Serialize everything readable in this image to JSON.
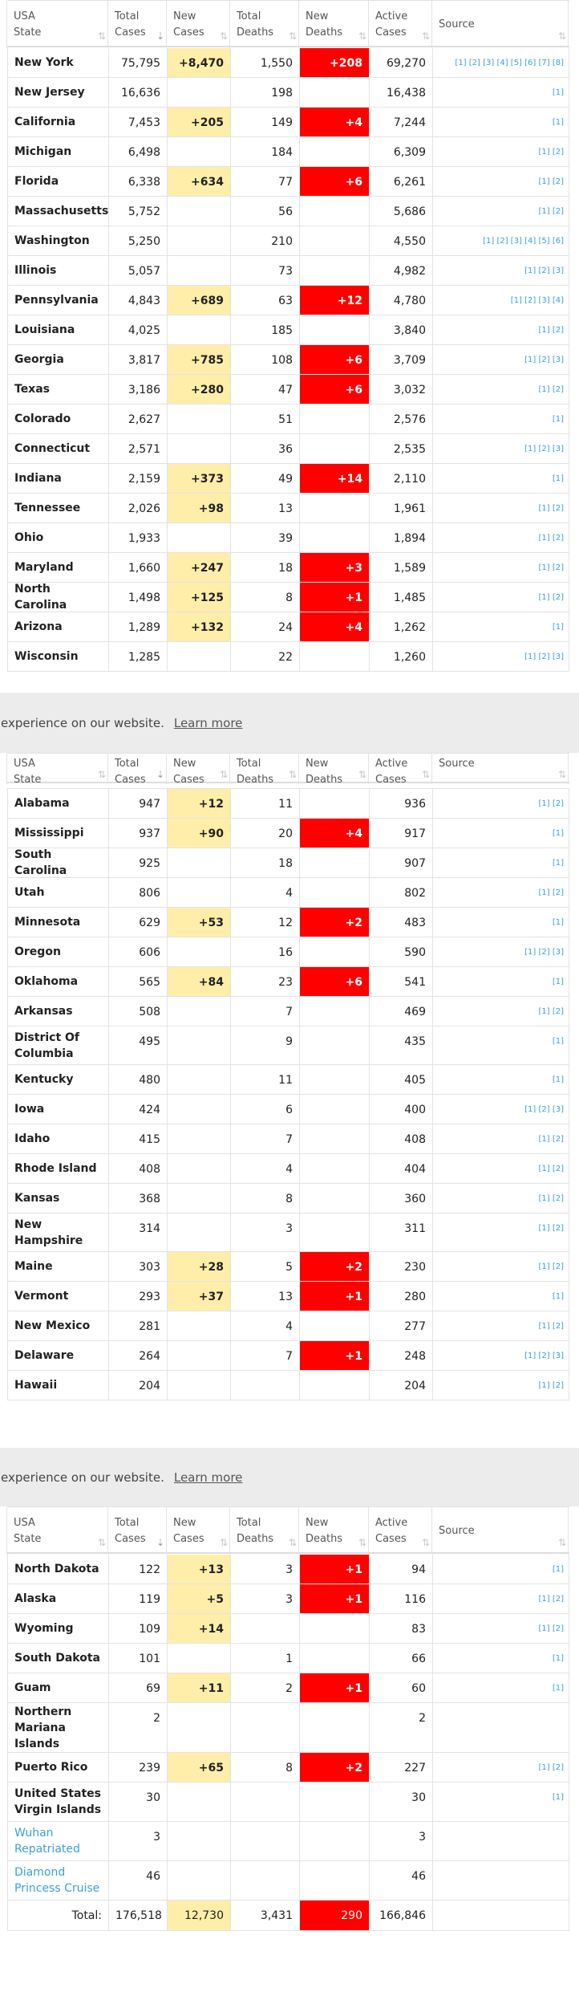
{
  "columns": {
    "state": [
      "USA",
      "State"
    ],
    "total_cases": [
      "Total",
      "Cases"
    ],
    "new_cases": [
      "New",
      "Cases"
    ],
    "total_deaths": [
      "Total",
      "Deaths"
    ],
    "new_deaths": [
      "New",
      "Deaths"
    ],
    "active_cases": [
      "Active",
      "Cases"
    ],
    "source": "Source",
    "sort_icon": "⇅",
    "sort_icon_active": "⇣"
  },
  "cookie_banner": {
    "text": "experience on our website.",
    "link": "Learn more"
  },
  "segments": [
    {
      "rows": [
        {
          "state": "New York",
          "total_cases": "75,795",
          "new_cases": "+8,470",
          "total_deaths": "1,550",
          "new_deaths": "+208",
          "active_cases": "69,270",
          "source": "[1] [2] [3] [4] [5] [6] [7] [8]"
        },
        {
          "state": "New Jersey",
          "total_cases": "16,636",
          "new_cases": "",
          "total_deaths": "198",
          "new_deaths": "",
          "active_cases": "16,438",
          "source": "[1]"
        },
        {
          "state": "California",
          "total_cases": "7,453",
          "new_cases": "+205",
          "total_deaths": "149",
          "new_deaths": "+4",
          "active_cases": "7,244",
          "source": "[1]"
        },
        {
          "state": "Michigan",
          "total_cases": "6,498",
          "new_cases": "",
          "total_deaths": "184",
          "new_deaths": "",
          "active_cases": "6,309",
          "source": "[1] [2]"
        },
        {
          "state": "Florida",
          "total_cases": "6,338",
          "new_cases": "+634",
          "total_deaths": "77",
          "new_deaths": "+6",
          "active_cases": "6,261",
          "source": "[1] [2]"
        },
        {
          "state": "Massachusetts",
          "total_cases": "5,752",
          "new_cases": "",
          "total_deaths": "56",
          "new_deaths": "",
          "active_cases": "5,686",
          "source": "[1] [2]"
        },
        {
          "state": "Washington",
          "total_cases": "5,250",
          "new_cases": "",
          "total_deaths": "210",
          "new_deaths": "",
          "active_cases": "4,550",
          "source": "[1] [2] [3] [4] [5] [6]"
        },
        {
          "state": "Illinois",
          "total_cases": "5,057",
          "new_cases": "",
          "total_deaths": "73",
          "new_deaths": "",
          "active_cases": "4,982",
          "source": "[1] [2] [3]"
        },
        {
          "state": "Pennsylvania",
          "total_cases": "4,843",
          "new_cases": "+689",
          "total_deaths": "63",
          "new_deaths": "+12",
          "active_cases": "4,780",
          "source": "[1] [2] [3] [4]"
        },
        {
          "state": "Louisiana",
          "total_cases": "4,025",
          "new_cases": "",
          "total_deaths": "185",
          "new_deaths": "",
          "active_cases": "3,840",
          "source": "[1] [2]"
        },
        {
          "state": "Georgia",
          "total_cases": "3,817",
          "new_cases": "+785",
          "total_deaths": "108",
          "new_deaths": "+6",
          "active_cases": "3,709",
          "source": "[1] [2] [3]"
        },
        {
          "state": "Texas",
          "total_cases": "3,186",
          "new_cases": "+280",
          "total_deaths": "47",
          "new_deaths": "+6",
          "active_cases": "3,032",
          "source": "[1] [2]"
        },
        {
          "state": "Colorado",
          "total_cases": "2,627",
          "new_cases": "",
          "total_deaths": "51",
          "new_deaths": "",
          "active_cases": "2,576",
          "source": "[1]"
        },
        {
          "state": "Connecticut",
          "total_cases": "2,571",
          "new_cases": "",
          "total_deaths": "36",
          "new_deaths": "",
          "active_cases": "2,535",
          "source": "[1] [2] [3]"
        },
        {
          "state": "Indiana",
          "total_cases": "2,159",
          "new_cases": "+373",
          "total_deaths": "49",
          "new_deaths": "+14",
          "active_cases": "2,110",
          "source": "[1]"
        },
        {
          "state": "Tennessee",
          "total_cases": "2,026",
          "new_cases": "+98",
          "total_deaths": "13",
          "new_deaths": "",
          "active_cases": "1,961",
          "source": "[1] [2]"
        },
        {
          "state": "Ohio",
          "total_cases": "1,933",
          "new_cases": "",
          "total_deaths": "39",
          "new_deaths": "",
          "active_cases": "1,894",
          "source": "[1] [2]"
        },
        {
          "state": "Maryland",
          "total_cases": "1,660",
          "new_cases": "+247",
          "total_deaths": "18",
          "new_deaths": "+3",
          "active_cases": "1,589",
          "source": "[1] [2]"
        },
        {
          "state": "North Carolina",
          "total_cases": "1,498",
          "new_cases": "+125",
          "total_deaths": "8",
          "new_deaths": "+1",
          "active_cases": "1,485",
          "source": "[1] [2]"
        },
        {
          "state": "Arizona",
          "total_cases": "1,289",
          "new_cases": "+132",
          "total_deaths": "24",
          "new_deaths": "+4",
          "active_cases": "1,262",
          "source": "[1]"
        },
        {
          "state": "Wisconsin",
          "total_cases": "1,285",
          "new_cases": "",
          "total_deaths": "22",
          "new_deaths": "",
          "active_cases": "1,260",
          "source": "[1] [2] [3]"
        }
      ]
    },
    {
      "rows": [
        {
          "state": "Alabama",
          "total_cases": "947",
          "new_cases": "+12",
          "total_deaths": "11",
          "new_deaths": "",
          "active_cases": "936",
          "source": "[1] [2]"
        },
        {
          "state": "Mississippi",
          "total_cases": "937",
          "new_cases": "+90",
          "total_deaths": "20",
          "new_deaths": "+4",
          "active_cases": "917",
          "source": "[1]"
        },
        {
          "state": "South Carolina",
          "total_cases": "925",
          "new_cases": "",
          "total_deaths": "18",
          "new_deaths": "",
          "active_cases": "907",
          "source": "[1]"
        },
        {
          "state": "Utah",
          "total_cases": "806",
          "new_cases": "",
          "total_deaths": "4",
          "new_deaths": "",
          "active_cases": "802",
          "source": "[1] [2]"
        },
        {
          "state": "Minnesota",
          "total_cases": "629",
          "new_cases": "+53",
          "total_deaths": "12",
          "new_deaths": "+2",
          "active_cases": "483",
          "source": "[1]"
        },
        {
          "state": "Oregon",
          "total_cases": "606",
          "new_cases": "",
          "total_deaths": "16",
          "new_deaths": "",
          "active_cases": "590",
          "source": "[1] [2] [3]"
        },
        {
          "state": "Oklahoma",
          "total_cases": "565",
          "new_cases": "+84",
          "total_deaths": "23",
          "new_deaths": "+6",
          "active_cases": "541",
          "source": "[1]"
        },
        {
          "state": "Arkansas",
          "total_cases": "508",
          "new_cases": "",
          "total_deaths": "7",
          "new_deaths": "",
          "active_cases": "469",
          "source": "[1] [2]"
        },
        {
          "state": "District Of Columbia",
          "total_cases": "495",
          "new_cases": "",
          "total_deaths": "9",
          "new_deaths": "",
          "active_cases": "435",
          "source": "[1]",
          "tall": true
        },
        {
          "state": "Kentucky",
          "total_cases": "480",
          "new_cases": "",
          "total_deaths": "11",
          "new_deaths": "",
          "active_cases": "405",
          "source": "[1]"
        },
        {
          "state": "Iowa",
          "total_cases": "424",
          "new_cases": "",
          "total_deaths": "6",
          "new_deaths": "",
          "active_cases": "400",
          "source": "[1] [2] [3]"
        },
        {
          "state": "Idaho",
          "total_cases": "415",
          "new_cases": "",
          "total_deaths": "7",
          "new_deaths": "",
          "active_cases": "408",
          "source": "[1] [2]"
        },
        {
          "state": "Rhode Island",
          "total_cases": "408",
          "new_cases": "",
          "total_deaths": "4",
          "new_deaths": "",
          "active_cases": "404",
          "source": "[1] [2]"
        },
        {
          "state": "Kansas",
          "total_cases": "368",
          "new_cases": "",
          "total_deaths": "8",
          "new_deaths": "",
          "active_cases": "360",
          "source": "[1] [2]"
        },
        {
          "state": "New Hampshire",
          "total_cases": "314",
          "new_cases": "",
          "total_deaths": "3",
          "new_deaths": "",
          "active_cases": "311",
          "source": "[1] [2]",
          "tall": true
        },
        {
          "state": "Maine",
          "total_cases": "303",
          "new_cases": "+28",
          "total_deaths": "5",
          "new_deaths": "+2",
          "active_cases": "230",
          "source": "[1] [2]"
        },
        {
          "state": "Vermont",
          "total_cases": "293",
          "new_cases": "+37",
          "total_deaths": "13",
          "new_deaths": "+1",
          "active_cases": "280",
          "source": "[1]"
        },
        {
          "state": "New Mexico",
          "total_cases": "281",
          "new_cases": "",
          "total_deaths": "4",
          "new_deaths": "",
          "active_cases": "277",
          "source": "[1] [2]"
        },
        {
          "state": "Delaware",
          "total_cases": "264",
          "new_cases": "",
          "total_deaths": "7",
          "new_deaths": "+1",
          "active_cases": "248",
          "source": "[1] [2] [3]"
        },
        {
          "state": "Hawaii",
          "total_cases": "204",
          "new_cases": "",
          "total_deaths": "",
          "new_deaths": "",
          "active_cases": "204",
          "source": "[1] [2]"
        }
      ]
    },
    {
      "rows": [
        {
          "state": "North Dakota",
          "total_cases": "122",
          "new_cases": "+13",
          "total_deaths": "3",
          "new_deaths": "+1",
          "active_cases": "94",
          "source": "[1]"
        },
        {
          "state": "Alaska",
          "total_cases": "119",
          "new_cases": "+5",
          "total_deaths": "3",
          "new_deaths": "+1",
          "active_cases": "116",
          "source": "[1] [2]"
        },
        {
          "state": "Wyoming",
          "total_cases": "109",
          "new_cases": "+14",
          "total_deaths": "",
          "new_deaths": "",
          "active_cases": "83",
          "source": "[1] [2]"
        },
        {
          "state": "South Dakota",
          "total_cases": "101",
          "new_cases": "",
          "total_deaths": "1",
          "new_deaths": "",
          "active_cases": "66",
          "source": "[1]"
        },
        {
          "state": "Guam",
          "total_cases": "69",
          "new_cases": "+11",
          "total_deaths": "2",
          "new_deaths": "+1",
          "active_cases": "60",
          "source": "[1]"
        },
        {
          "state": "Northern Mariana Islands",
          "total_cases": "2",
          "new_cases": "",
          "total_deaths": "",
          "new_deaths": "",
          "active_cases": "2",
          "source": "",
          "h": "xl"
        },
        {
          "state": "Puerto Rico",
          "total_cases": "239",
          "new_cases": "+65",
          "total_deaths": "8",
          "new_deaths": "+2",
          "active_cases": "227",
          "source": "[1] [2]"
        },
        {
          "state": "United States Virgin Islands",
          "total_cases": "30",
          "new_cases": "",
          "total_deaths": "",
          "new_deaths": "",
          "active_cases": "30",
          "source": "[1]",
          "h": "lg"
        },
        {
          "state": "Wuhan Repatriated",
          "total_cases": "3",
          "new_cases": "",
          "total_deaths": "",
          "new_deaths": "",
          "active_cases": "3",
          "source": "",
          "h": "lg",
          "link": true
        },
        {
          "state": "Diamond Princess Cruise",
          "total_cases": "46",
          "new_cases": "",
          "total_deaths": "",
          "new_deaths": "",
          "active_cases": "46",
          "source": "",
          "h": "lg",
          "link": true
        }
      ],
      "total": {
        "label": "Total:",
        "total_cases": "176,518",
        "new_cases": "12,730",
        "total_deaths": "3,431",
        "new_deaths": "290",
        "active_cases": "166,846"
      }
    }
  ],
  "colors": {
    "new_cases_bg": "#ffeeaa",
    "new_deaths_bg": "#ff0000",
    "link": "#3aa0e0"
  }
}
